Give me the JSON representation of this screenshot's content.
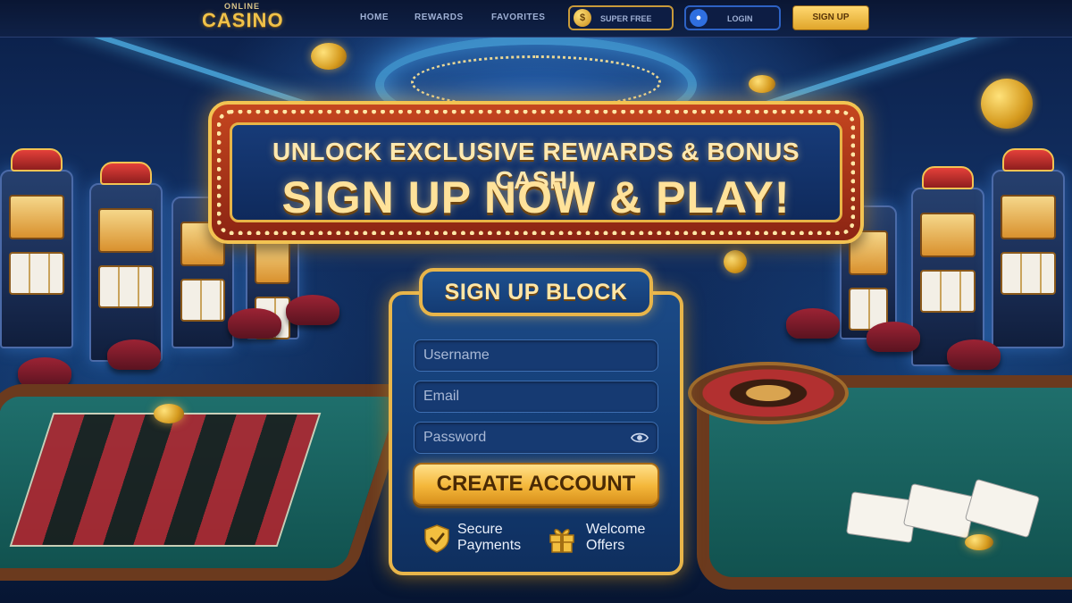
{
  "nav": {
    "logo_small": "ONLINE",
    "logo_big": "CASINO",
    "links": [
      "HOME",
      "REWARDS",
      "FAVORITES"
    ],
    "bonus_label": "SUPER FREE",
    "login_label": "LOGIN",
    "signup_label": "SIGN UP"
  },
  "banner": {
    "line1": "UNLOCK EXCLUSIVE REWARDS & BONUS CASH!",
    "line2": "SIGN UP NOW & PLAY!"
  },
  "signup": {
    "title": "SIGN UP BLOCK",
    "username_placeholder": "Username",
    "email_placeholder": "Email",
    "password_placeholder": "Password",
    "create_label": "CREATE ACCOUNT",
    "features": [
      {
        "line1": "Secure",
        "line2": "Payments",
        "icon": "shield-check-icon"
      },
      {
        "line1": "Welcome",
        "line2": "Offers",
        "icon": "gift-icon"
      }
    ]
  },
  "colors": {
    "gold": "#f0c24a",
    "navy": "#0f2147",
    "card_blue": "#1b4a86",
    "marquee_red": "#c5461f"
  }
}
